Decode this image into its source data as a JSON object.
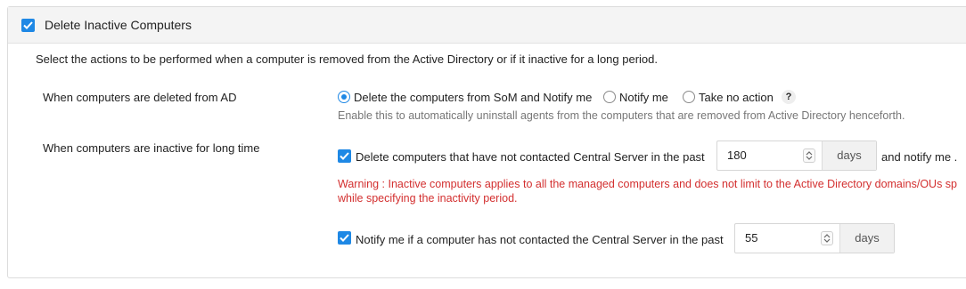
{
  "header": {
    "title": "Delete Inactive Computers",
    "checked": true
  },
  "description": "Select the actions to be performed when a computer is removed from the Active Directory or if it inactive for a long period.",
  "deleted_from_ad": {
    "label": "When computers are deleted from AD",
    "options": [
      {
        "label": "Delete the computers from SoM and Notify me",
        "selected": true
      },
      {
        "label": "Notify me",
        "selected": false
      },
      {
        "label": "Take no action",
        "selected": false
      }
    ],
    "help": "?",
    "hint": "Enable this to automatically uninstall agents from the computers that are removed from Active Directory henceforth."
  },
  "inactive": {
    "label": "When computers are inactive for long time",
    "delete_rule": {
      "label": "Delete computers that have not contacted Central Server in the past",
      "checked": true,
      "value": "180",
      "unit": "days",
      "suffix": "and notify me ."
    },
    "warning_line1": "Warning : Inactive computers applies to all the managed computers and does not limit to the Active Directory domains/OUs sp",
    "warning_line2": "while specifying the inactivity period.",
    "notify_rule": {
      "label": "Notify me if a computer has not contacted the Central Server in the past",
      "checked": true,
      "value": "55",
      "unit": "days"
    }
  },
  "colors": {
    "accent": "#1e88e5",
    "warning": "#d32f2f",
    "hint": "#777777"
  }
}
